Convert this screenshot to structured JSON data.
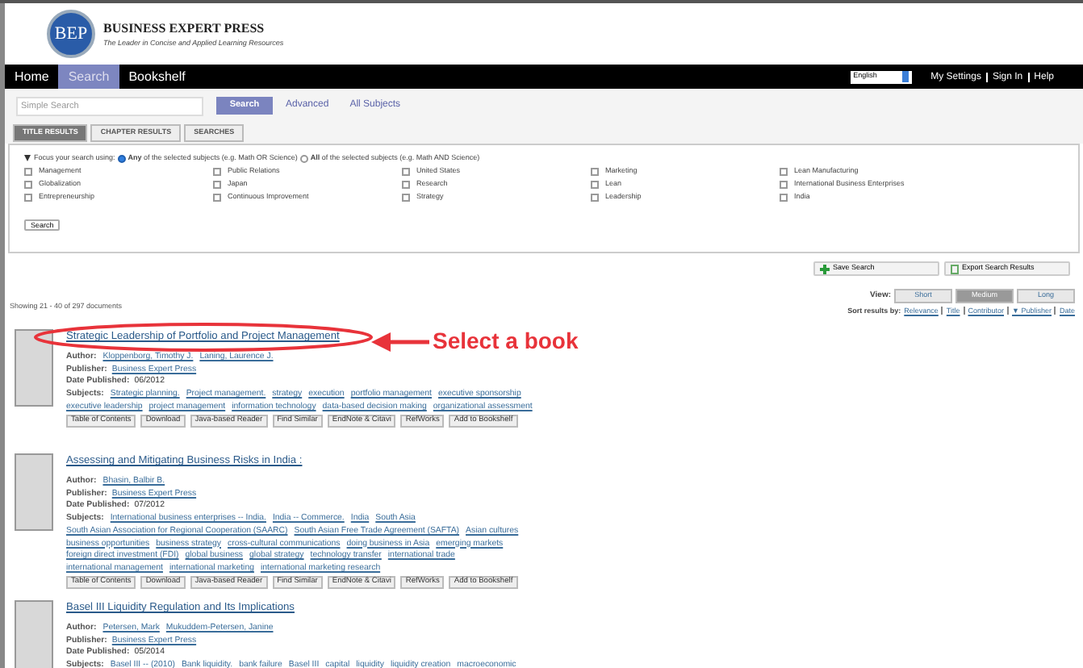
{
  "header": {
    "logo": "BEP",
    "title": "BUSINESS EXPERT PRESS",
    "tagline": "The Leader in Concise and Applied Learning Resources"
  },
  "nav": [
    {
      "label": "Home",
      "selected": false
    },
    {
      "label": "Search",
      "selected": true
    },
    {
      "label": "Bookshelf",
      "selected": false
    }
  ],
  "language": "English",
  "account_links": [
    "My Settings",
    "Sign In",
    "Help"
  ],
  "search": {
    "placeholder": "Simple Search",
    "button": "Search",
    "links": [
      "Advanced",
      "All Subjects"
    ]
  },
  "tabs": [
    {
      "label": "TITLE RESULTS",
      "selected": true
    },
    {
      "label": "CHAPTER RESULTS",
      "selected": false
    },
    {
      "label": "SEARCHES",
      "selected": false
    }
  ],
  "filter": {
    "prompt": "Focus your search using:",
    "expanded": true,
    "modes": [
      {
        "label": "**Any** of the selected subjects (e.g. Math OR Science)",
        "selected": true
      },
      {
        "label": "**All** of the selected subjects (e.g. Math AND Science)",
        "selected": false
      }
    ],
    "subjects": [
      {
        "label": "Management",
        "checked": false
      },
      {
        "label": "Public Relations",
        "checked": false
      },
      {
        "label": "United States",
        "checked": false
      },
      {
        "label": "Marketing",
        "checked": false
      },
      {
        "label": "Lean Manufacturing",
        "checked": false
      },
      {
        "label": "Globalization",
        "checked": false
      },
      {
        "label": "Japan",
        "checked": false
      },
      {
        "label": "Research",
        "checked": false
      },
      {
        "label": "Lean",
        "checked": false
      },
      {
        "label": "International Business Enterprises",
        "checked": false
      },
      {
        "label": "Entrepreneurship",
        "checked": false
      },
      {
        "label": "Continuous Improvement",
        "checked": false
      },
      {
        "label": "Strategy",
        "checked": false
      },
      {
        "label": "Leadership",
        "checked": false
      },
      {
        "label": "India",
        "checked": false
      }
    ],
    "button": "Search"
  },
  "actions": [
    "Save Search",
    "Export Search Results"
  ],
  "view": {
    "label": "View:",
    "options": [
      {
        "label": "Short",
        "selected": false
      },
      {
        "label": "Medium",
        "selected": true
      },
      {
        "label": "Long",
        "selected": false
      }
    ]
  },
  "sort": {
    "label": "Sort results by:",
    "options": [
      "Relevance",
      "Title",
      "Contributor",
      "▼ Publisher",
      "Date"
    ]
  },
  "showing": "Showing 21 - 40 of 297 documents",
  "results": [
    {
      "title": "Strategic Leadership of Portfolio and Project Management",
      "author_label": "Author:",
      "authors": [
        "Kloppenborg, Timothy J.",
        "Laning, Laurence J."
      ],
      "publisher_label": "Publisher:",
      "publisher": "Business Expert Press",
      "date_label": "Date Published:",
      "date": "06/2012",
      "subjects_label": "Subjects:",
      "subjects": [
        "Strategic planning.",
        "Project management.",
        "strategy",
        "execution",
        "portfolio management",
        "executive sponsorship",
        "executive leadership",
        "project management",
        "information technology",
        "data-based decision making",
        "organizational assessment"
      ],
      "buttons": [
        "Table of Contents",
        "Download",
        "Java-based Reader",
        "Find Similar",
        "EndNote & Citavi",
        "RefWorks",
        "Add to Bookshelf"
      ]
    },
    {
      "title": "Assessing and Mitigating Business Risks in India :",
      "author_label": "Author:",
      "authors": [
        "Bhasin, Balbir B."
      ],
      "publisher_label": "Publisher:",
      "publisher": "Business Expert Press",
      "date_label": "Date Published:",
      "date": "07/2012",
      "subjects_label": "Subjects:",
      "subjects": [
        "International business enterprises -- India.",
        "India -- Commerce.",
        "India",
        "South Asia",
        "South Asian Association for Regional Cooperation (SAARC)",
        "South Asian Free Trade Agreement (SAFTA)",
        "Asian cultures",
        "business opportunities",
        "business strategy",
        "cross-cultural communications",
        "doing business in Asia",
        "emerging markets",
        "foreign direct investment (FDI)",
        "global business",
        "global strategy",
        "technology transfer",
        "international trade",
        "international management",
        "international marketing",
        "international marketing research"
      ],
      "buttons": [
        "Table of Contents",
        "Download",
        "Java-based Reader",
        "Find Similar",
        "EndNote & Citavi",
        "RefWorks",
        "Add to Bookshelf"
      ]
    },
    {
      "title": "Basel III Liquidity Regulation and Its Implications",
      "author_label": "Author:",
      "authors": [
        "Petersen, Mark",
        "Mukuddem-Petersen, Janine"
      ],
      "publisher_label": "Publisher:",
      "publisher": "Business Expert Press",
      "date_label": "Date Published:",
      "date": "05/2014",
      "subjects_label": "Subjects:",
      "subjects": [
        "Basel III -- (2010)",
        "Bank liquidity.",
        "bank failure",
        "Basel III",
        "capital",
        "liquidity",
        "liquidity creation",
        "macroeconomic"
      ]
    }
  ],
  "annotation": {
    "label": "Select a book"
  }
}
